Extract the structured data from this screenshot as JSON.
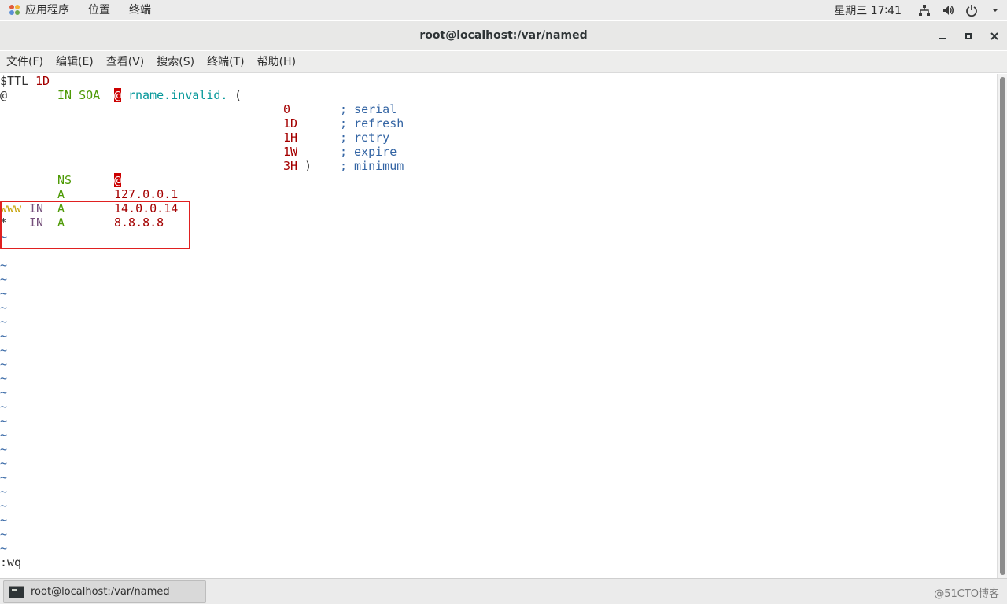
{
  "panel": {
    "applications": "应用程序",
    "places": "位置",
    "terminal": "终端",
    "clock": "星期三 17∶41"
  },
  "window": {
    "title": "root@localhost:/var/named"
  },
  "menu": {
    "file": "文件(F)",
    "edit": "编辑(E)",
    "view": "查看(V)",
    "search": "搜索(S)",
    "terminal": "终端(T)",
    "help": "帮助(H)"
  },
  "editor": {
    "ttl_key": "$TTL",
    "ttl_val": "1D",
    "soa_at": "@",
    "soa_in": "IN SOA",
    "soa_origin": "@",
    "soa_rname": "rname.invalid.",
    "soa_paren": "(",
    "serial_val": "0",
    "serial_cmt": "; serial",
    "refresh_val": "1D",
    "refresh_cmt": "; refresh",
    "retry_val": "1H",
    "retry_cmt": "; retry",
    "expire_val": "1W",
    "expire_cmt": "; expire",
    "min_val": "3H",
    "min_paren": ")",
    "min_cmt": "; minimum",
    "ns_type": "NS",
    "ns_val": "@",
    "a_type": "A",
    "a_val": "127.0.0.1",
    "www_name": "www",
    "www_in": "IN",
    "www_type": "A",
    "www_val": "14.0.0.14",
    "star_name": "*",
    "star_in": "IN",
    "star_type": "A",
    "star_val": "8.8.8.8",
    "tilde": "~",
    "command": ":wq"
  },
  "taskbar": {
    "window_item": "root@localhost:/var/named",
    "watermark": "@51CTO博客"
  }
}
